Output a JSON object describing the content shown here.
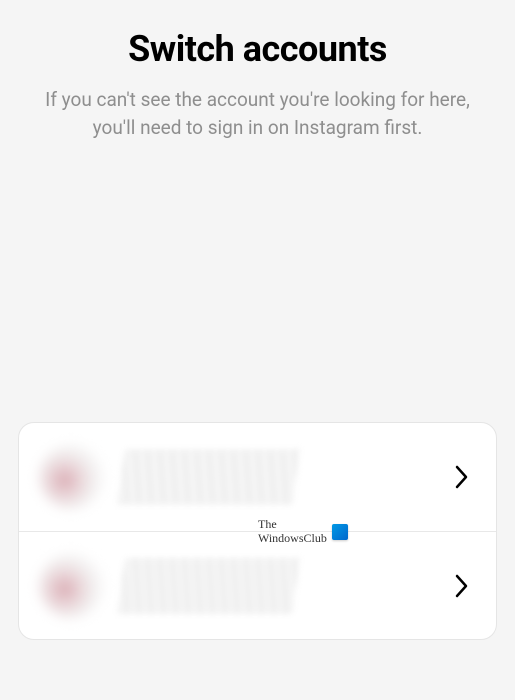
{
  "header": {
    "title": "Switch accounts",
    "subtitle": "If you can't see the account you're looking for here, you'll need to sign in on Instagram first."
  },
  "accounts": [
    {
      "id": "account-1"
    },
    {
      "id": "account-2"
    }
  ],
  "watermark": {
    "line1": "The",
    "line2": "WindowsClub"
  }
}
